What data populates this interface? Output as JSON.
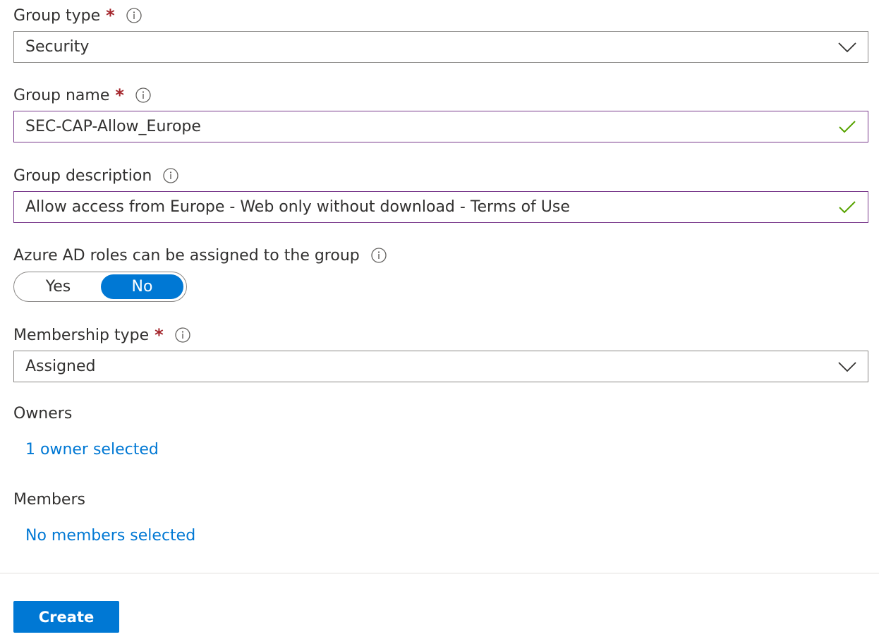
{
  "group_type": {
    "label": "Group type",
    "required_mark": "*",
    "value": "Security"
  },
  "group_name": {
    "label": "Group name",
    "required_mark": "*",
    "value": "SEC-CAP-Allow_Europe"
  },
  "group_description": {
    "label": "Group description",
    "value": "Allow access from Europe - Web only without download - Terms of Use"
  },
  "azure_ad_roles": {
    "label": "Azure AD roles can be assigned to the group",
    "options": [
      "Yes",
      "No"
    ],
    "selected": "No"
  },
  "membership_type": {
    "label": "Membership type",
    "required_mark": "*",
    "value": "Assigned"
  },
  "owners": {
    "label": "Owners",
    "link_text": "1 owner selected"
  },
  "members": {
    "label": "Members",
    "link_text": "No members selected"
  },
  "actions": {
    "create_label": "Create"
  },
  "colors": {
    "accent": "#0078d4",
    "required": "#a4262c",
    "valid_check": "#57a300",
    "valid_border": "#7a3a8c"
  },
  "icons": {
    "info": "info-icon",
    "dropdown": "chevron-down-icon",
    "valid": "checkmark-icon"
  }
}
